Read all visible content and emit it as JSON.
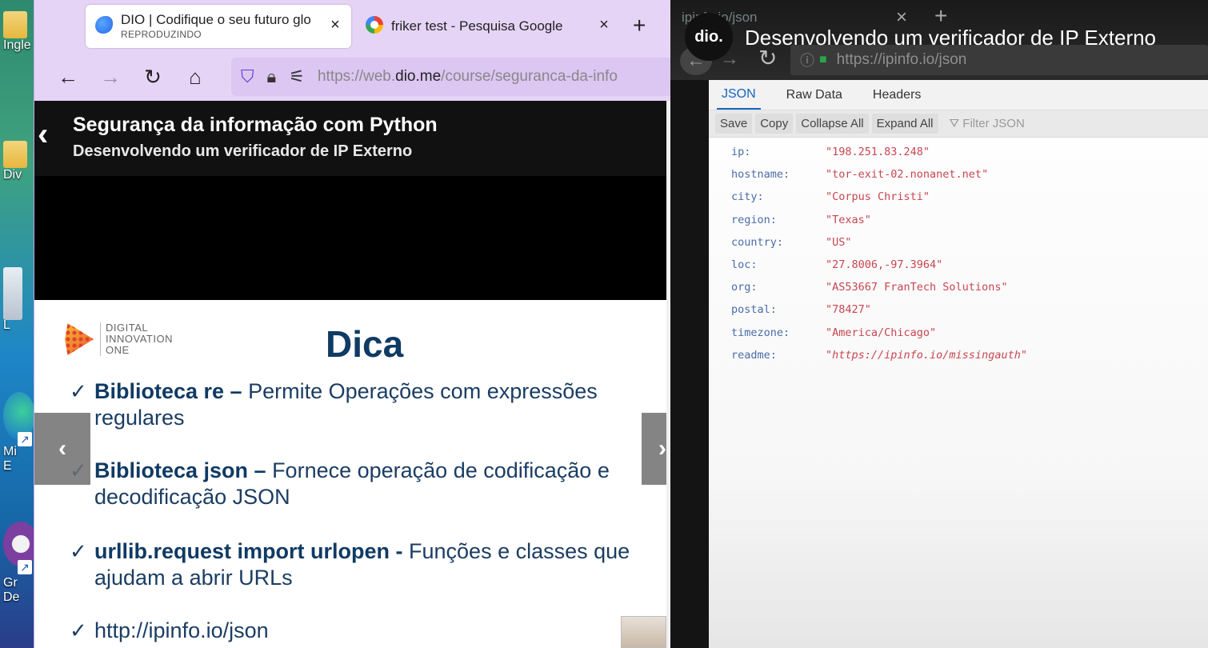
{
  "desktop": {
    "icons": [
      {
        "label": "Ingle",
        "type": "folder"
      },
      {
        "label": "Div",
        "type": "folder"
      },
      {
        "label": "L",
        "type": "recycle"
      },
      {
        "label": "Mi\nE",
        "type": "edge"
      },
      {
        "label": "Gr\nDe",
        "type": "app"
      }
    ]
  },
  "browser": {
    "tabs": [
      {
        "title": "DIO | Codifique o seu futuro glo",
        "subtitle": "REPRODUZINDO",
        "close": "×",
        "favicon": "dio-icon"
      },
      {
        "title": "friker test - Pesquisa Google",
        "close": "×",
        "favicon": "google-icon"
      }
    ],
    "new_tab": "+",
    "nav": {
      "back": "←",
      "forward": "→",
      "reload": "↻",
      "home": "⌂"
    },
    "url": {
      "prefix": "https://web.",
      "domain": "dio.me",
      "path": "/course/seguranca-da-info"
    },
    "course": {
      "back": "‹",
      "title": "Segurança da informação com Python",
      "subtitle": "Desenvolvendo um verificador de IP Externo"
    },
    "slide": {
      "logo_lines": [
        "DIGITAL",
        "INNOVATION",
        "ONE"
      ],
      "title": "Dica",
      "bullets": [
        {
          "bold": "Biblioteca re –",
          "text": " Permite Operações com expressões regulares"
        },
        {
          "bold": "Biblioteca json –",
          "text": " Fornece operação de codificação e decodificação JSON"
        },
        {
          "bold": "urllib.request import urlopen -",
          "text": " Funções e classes que ajudam a abrir URLs"
        },
        {
          "bold": "",
          "text": "http://ipinfo.io/json"
        }
      ],
      "check": "✓",
      "prev": "‹",
      "next": "›"
    }
  },
  "video": {
    "channel_avatar": "dio.",
    "title": "Desenvolvendo um verificador de IP Externo",
    "inner_browser": {
      "tab_title": "ipinfo.io/json",
      "tab_close": "×",
      "new_tab": "+",
      "url": "https://ipinfo.io/json"
    },
    "json_viewer": {
      "tabs": [
        "JSON",
        "Raw Data",
        "Headers"
      ],
      "toolbar": [
        "Save",
        "Copy",
        "Collapse All",
        "Expand All"
      ],
      "filter_placeholder": "Filter JSON",
      "rows": [
        {
          "key": "ip:",
          "value": "\"198.251.83.248\""
        },
        {
          "key": "hostname:",
          "value": "\"tor-exit-02.nonanet.net\""
        },
        {
          "key": "city:",
          "value": "\"Corpus Christi\""
        },
        {
          "key": "region:",
          "value": "\"Texas\""
        },
        {
          "key": "country:",
          "value": "\"US\""
        },
        {
          "key": "loc:",
          "value": "\"27.8006,-97.3964\""
        },
        {
          "key": "org:",
          "value": "\"AS53667 FranTech Solutions\""
        },
        {
          "key": "postal:",
          "value": "\"78427\""
        },
        {
          "key": "timezone:",
          "value": "\"America/Chicago\""
        },
        {
          "key": "readme:",
          "value": "\"https://ipinfo.io/missingauth\""
        }
      ]
    }
  }
}
